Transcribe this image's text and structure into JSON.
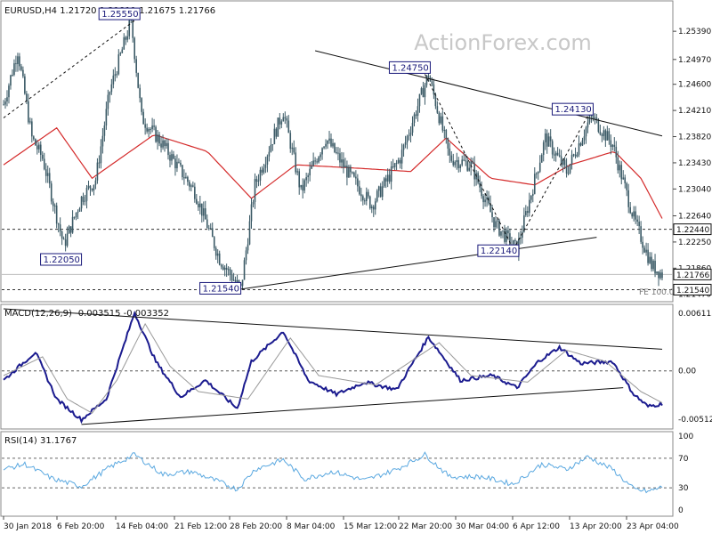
{
  "watermark": "ActionForex.com",
  "colors": {
    "candle": "#3b5a66",
    "ma": "#d42a2a",
    "trendline": "#111111",
    "macd": "#1b1b8f",
    "signal": "#999999",
    "rsi": "#5aa8e0",
    "box_border": "#1a1a7a",
    "grid_ref": "#555555"
  },
  "chart_data": [
    {
      "type": "candlestick",
      "title": "EURUSD,H4  1.21720 1.21811 1.21675 1.21766",
      "symbol": "EURUSD",
      "timeframe": "H4",
      "ohlc_last": [
        1.2172,
        1.21811,
        1.21675,
        1.21766
      ],
      "ylim": [
        1.214,
        1.2575
      ],
      "y_ticks": [
        "1.25390",
        "1.24970",
        "1.24600",
        "1.24210",
        "1.23820",
        "1.23430",
        "1.23040",
        "1.22640",
        "1.22250",
        "1.21860",
        "1.21470"
      ],
      "x_tick_labels": [
        "30 Jan 2018",
        "6 Feb 20:00",
        "14 Feb 04:00",
        "21 Feb 12:00",
        "28 Feb 20:00",
        "8 Mar 04:00",
        "15 Mar 12:00",
        "22 Mar 20:00",
        "30 Mar 04:00",
        "6 Apr 12:00",
        "13 Apr 20:00",
        "23 Apr 04:00"
      ],
      "anchors": [
        {
          "bar": 0,
          "price": 1.243
        },
        {
          "bar": 8,
          "price": 1.251
        },
        {
          "bar": 16,
          "price": 1.238
        },
        {
          "bar": 22,
          "price": 1.235
        },
        {
          "bar": 34,
          "price": 1.222
        },
        {
          "bar": 44,
          "price": 1.229
        },
        {
          "bar": 52,
          "price": 1.2318
        },
        {
          "bar": 60,
          "price": 1.245
        },
        {
          "bar": 72,
          "price": 1.2555
        },
        {
          "bar": 78,
          "price": 1.241
        },
        {
          "bar": 90,
          "price": 1.237
        },
        {
          "bar": 108,
          "price": 1.23
        },
        {
          "bar": 122,
          "price": 1.22
        },
        {
          "bar": 134,
          "price": 1.2154
        },
        {
          "bar": 142,
          "price": 1.231
        },
        {
          "bar": 158,
          "price": 1.242
        },
        {
          "bar": 168,
          "price": 1.23
        },
        {
          "bar": 182,
          "price": 1.238
        },
        {
          "bar": 194,
          "price": 1.233
        },
        {
          "bar": 208,
          "price": 1.228
        },
        {
          "bar": 224,
          "price": 1.235
        },
        {
          "bar": 240,
          "price": 1.2475
        },
        {
          "bar": 252,
          "price": 1.235
        },
        {
          "bar": 264,
          "price": 1.234
        },
        {
          "bar": 278,
          "price": 1.225
        },
        {
          "bar": 290,
          "price": 1.2214
        },
        {
          "bar": 306,
          "price": 1.238
        },
        {
          "bar": 318,
          "price": 1.233
        },
        {
          "bar": 332,
          "price": 1.2413
        },
        {
          "bar": 344,
          "price": 1.237
        },
        {
          "bar": 356,
          "price": 1.226
        },
        {
          "bar": 366,
          "price": 1.219
        },
        {
          "bar": 372,
          "price": 1.2177
        }
      ],
      "bar_count": 373,
      "moving_average_levels": [
        {
          "bar": 0,
          "price": 1.234
        },
        {
          "bar": 30,
          "price": 1.2395
        },
        {
          "bar": 50,
          "price": 1.232
        },
        {
          "bar": 85,
          "price": 1.2385
        },
        {
          "bar": 115,
          "price": 1.236
        },
        {
          "bar": 140,
          "price": 1.229
        },
        {
          "bar": 165,
          "price": 1.234
        },
        {
          "bar": 200,
          "price": 1.2335
        },
        {
          "bar": 230,
          "price": 1.233
        },
        {
          "bar": 250,
          "price": 1.238
        },
        {
          "bar": 275,
          "price": 1.232
        },
        {
          "bar": 300,
          "price": 1.231
        },
        {
          "bar": 320,
          "price": 1.234
        },
        {
          "bar": 345,
          "price": 1.236
        },
        {
          "bar": 360,
          "price": 1.232
        },
        {
          "bar": 372,
          "price": 1.226
        }
      ],
      "price_labels": [
        {
          "text": "1.25550",
          "bar": 74,
          "price": 1.2555
        },
        {
          "text": "1.24750",
          "bar": 238,
          "price": 1.2475
        },
        {
          "text": "1.24130",
          "bar": 330,
          "price": 1.2413
        },
        {
          "text": "1.22050",
          "bar": 40,
          "price": 1.2205
        },
        {
          "text": "1.22140",
          "bar": 288,
          "price": 1.2214
        },
        {
          "text": "1.21540",
          "bar": 132,
          "price": 1.2154
        }
      ],
      "right_tags": [
        {
          "text": "1.22440",
          "price": 1.2244
        },
        {
          "text": "1.21766",
          "price": 1.21766
        },
        {
          "text": "1.21540",
          "price": 1.2154
        }
      ],
      "horizontal_levels": [
        1.2244,
        1.2154
      ],
      "fib_label": "FE 100.0",
      "trendlines": [
        {
          "from": {
            "bar": 0,
            "price": 1.241
          },
          "to": {
            "bar": 74,
            "price": 1.2555
          },
          "style": "dashed"
        },
        {
          "from": {
            "bar": 176,
            "price": 1.251
          },
          "to": {
            "bar": 372,
            "price": 1.2383
          },
          "style": "solid"
        },
        {
          "from": {
            "bar": 132,
            "price": 1.2154
          },
          "to": {
            "bar": 335,
            "price": 1.2232
          },
          "style": "solid"
        },
        {
          "from": {
            "bar": 238,
            "price": 1.2475
          },
          "to": {
            "bar": 288,
            "price": 1.2214
          },
          "style": "dashed"
        },
        {
          "from": {
            "bar": 288,
            "price": 1.2214
          },
          "to": {
            "bar": 330,
            "price": 1.2413
          },
          "style": "dashed"
        }
      ]
    },
    {
      "type": "line",
      "title": "MACD(12,26,9) -0.003515 -0.003352",
      "ylim": [
        -0.006,
        0.0067
      ],
      "y_ticks": [
        "0.006113",
        "0.00",
        "-0.005124"
      ],
      "series": [
        {
          "name": "MACD",
          "points": [
            {
              "bar": 0,
              "value": -0.001
            },
            {
              "bar": 18,
              "value": 0.002
            },
            {
              "bar": 30,
              "value": -0.003
            },
            {
              "bar": 44,
              "value": -0.0052
            },
            {
              "bar": 58,
              "value": -0.003
            },
            {
              "bar": 74,
              "value": 0.0062
            },
            {
              "bar": 86,
              "value": 0.001
            },
            {
              "bar": 100,
              "value": -0.0028
            },
            {
              "bar": 114,
              "value": -0.001
            },
            {
              "bar": 132,
              "value": -0.004
            },
            {
              "bar": 140,
              "value": 0.001
            },
            {
              "bar": 158,
              "value": 0.0042
            },
            {
              "bar": 172,
              "value": -0.001
            },
            {
              "bar": 188,
              "value": -0.0025
            },
            {
              "bar": 204,
              "value": -0.0012
            },
            {
              "bar": 222,
              "value": -0.002
            },
            {
              "bar": 240,
              "value": 0.0036
            },
            {
              "bar": 258,
              "value": -0.001
            },
            {
              "bar": 276,
              "value": -0.0005
            },
            {
              "bar": 290,
              "value": -0.0018
            },
            {
              "bar": 302,
              "value": 0.001
            },
            {
              "bar": 314,
              "value": 0.0025
            },
            {
              "bar": 326,
              "value": 0.0008
            },
            {
              "bar": 344,
              "value": 0.001
            },
            {
              "bar": 356,
              "value": -0.0025
            },
            {
              "bar": 364,
              "value": -0.0038
            },
            {
              "bar": 372,
              "value": -0.0035
            }
          ]
        },
        {
          "name": "Signal",
          "points": [
            {
              "bar": 0,
              "value": -0.0005
            },
            {
              "bar": 22,
              "value": 0.0015
            },
            {
              "bar": 36,
              "value": -0.003
            },
            {
              "bar": 50,
              "value": -0.0045
            },
            {
              "bar": 64,
              "value": -0.001
            },
            {
              "bar": 80,
              "value": 0.005
            },
            {
              "bar": 94,
              "value": 0.0005
            },
            {
              "bar": 110,
              "value": -0.0022
            },
            {
              "bar": 138,
              "value": -0.003
            },
            {
              "bar": 162,
              "value": 0.0035
            },
            {
              "bar": 178,
              "value": -0.0005
            },
            {
              "bar": 210,
              "value": -0.0015
            },
            {
              "bar": 246,
              "value": 0.003
            },
            {
              "bar": 264,
              "value": -0.0005
            },
            {
              "bar": 296,
              "value": -0.0012
            },
            {
              "bar": 318,
              "value": 0.0022
            },
            {
              "bar": 340,
              "value": 0.001
            },
            {
              "bar": 360,
              "value": -0.0022
            },
            {
              "bar": 372,
              "value": -0.0034
            }
          ]
        }
      ],
      "trendlines": [
        {
          "from": {
            "bar": 0,
            "value": 0.0066
          },
          "to": {
            "bar": 372,
            "value": 0.0023
          }
        },
        {
          "from": {
            "bar": 44,
            "value": -0.0057
          },
          "to": {
            "bar": 350,
            "value": -0.0018
          }
        }
      ],
      "zero_line": 0
    },
    {
      "type": "line",
      "title": "RSI(14) 31.1767",
      "ylim": [
        0,
        100
      ],
      "y_ticks": [
        "100",
        "70",
        "30",
        "0"
      ],
      "reference_levels": [
        70,
        30
      ],
      "series": [
        {
          "name": "RSI",
          "points": [
            {
              "bar": 0,
              "value": 55
            },
            {
              "bar": 12,
              "value": 62
            },
            {
              "bar": 28,
              "value": 42
            },
            {
              "bar": 44,
              "value": 32
            },
            {
              "bar": 60,
              "value": 58
            },
            {
              "bar": 74,
              "value": 75
            },
            {
              "bar": 90,
              "value": 48
            },
            {
              "bar": 106,
              "value": 52
            },
            {
              "bar": 122,
              "value": 38
            },
            {
              "bar": 132,
              "value": 28
            },
            {
              "bar": 142,
              "value": 55
            },
            {
              "bar": 158,
              "value": 68
            },
            {
              "bar": 170,
              "value": 42
            },
            {
              "bar": 186,
              "value": 52
            },
            {
              "bar": 204,
              "value": 40
            },
            {
              "bar": 222,
              "value": 55
            },
            {
              "bar": 238,
              "value": 75
            },
            {
              "bar": 252,
              "value": 45
            },
            {
              "bar": 270,
              "value": 45
            },
            {
              "bar": 288,
              "value": 35
            },
            {
              "bar": 304,
              "value": 62
            },
            {
              "bar": 318,
              "value": 55
            },
            {
              "bar": 330,
              "value": 72
            },
            {
              "bar": 344,
              "value": 55
            },
            {
              "bar": 356,
              "value": 28
            },
            {
              "bar": 364,
              "value": 25
            },
            {
              "bar": 372,
              "value": 31
            }
          ]
        }
      ]
    }
  ]
}
